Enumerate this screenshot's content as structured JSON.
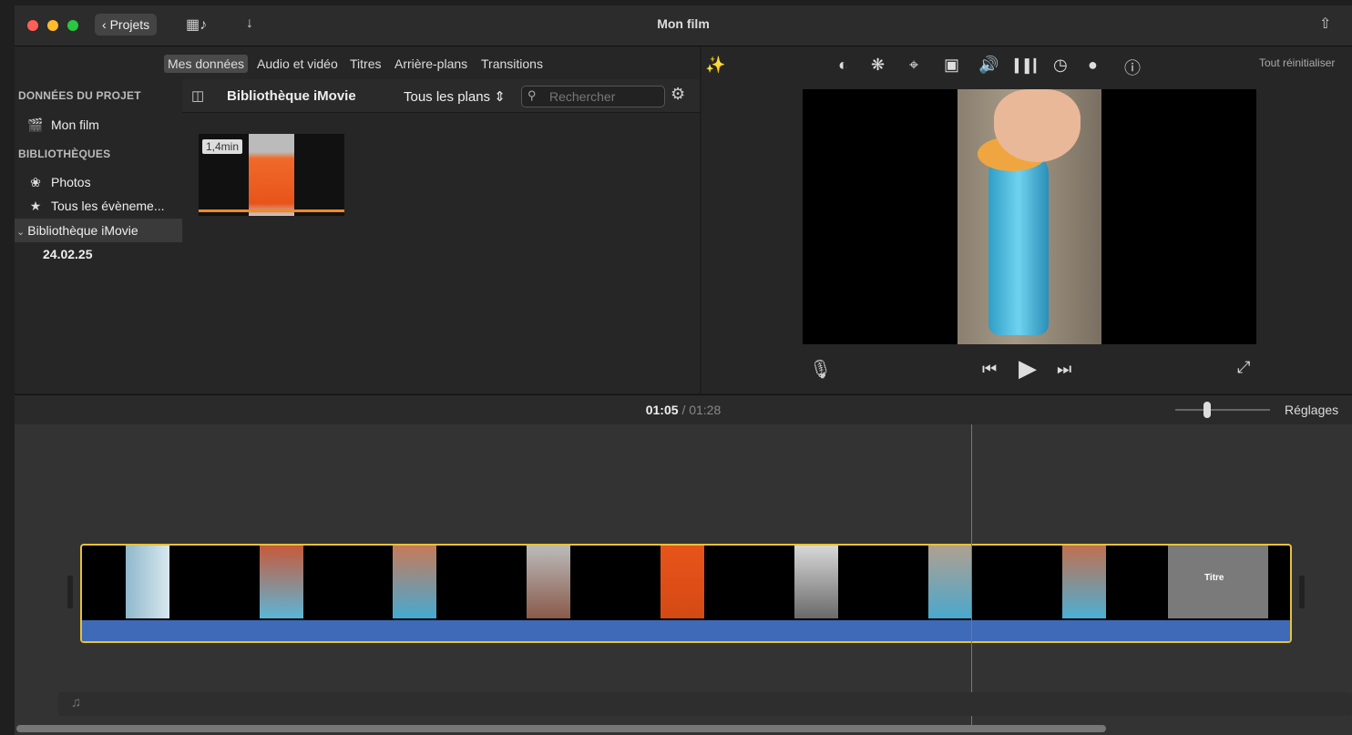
{
  "titlebar": {
    "back_label": "Projets",
    "title": "Mon film",
    "icons": [
      "film-music-icon",
      "import-arrow-icon",
      "share-icon"
    ]
  },
  "browser_tabs": [
    "Mes données",
    "Audio et vidéo",
    "Titres",
    "Arrière-plans",
    "Transitions"
  ],
  "sidebar": {
    "section_project": "DONNÉES DU PROJET",
    "project_item": "Mon film",
    "section_libraries": "BIBLIOTHÈQUES",
    "items": [
      "Photos",
      "Tous les évèneme...",
      "Bibliothèque iMovie",
      "24.02.25"
    ]
  },
  "browser": {
    "library_title": "Bibliothèque iMovie",
    "filter_label": "Tous les plans",
    "search_placeholder": "Rechercher",
    "clip_duration": "1,4min"
  },
  "viewer": {
    "reset_label": "Tout réinitialiser",
    "tool_icons": [
      "magic-wand-icon",
      "color-balance-icon",
      "palette-icon",
      "crop-icon",
      "stabilization-icon",
      "volume-icon",
      "equalizer-icon",
      "speed-icon",
      "filter-icon",
      "info-icon"
    ]
  },
  "timeline": {
    "current_time": "01:05",
    "separator": "/",
    "total_time": "01:28",
    "settings_label": "Réglages",
    "title_clip_text": "Titre"
  },
  "colors": {
    "accent_orange": "#f08a24",
    "clip_border": "#e6c23a",
    "audio_blue": "#3f6ab8"
  }
}
